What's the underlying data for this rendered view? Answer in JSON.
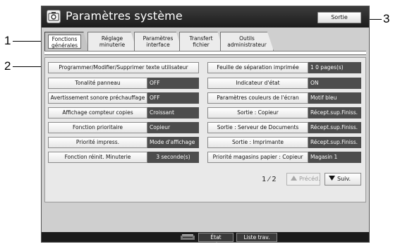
{
  "callouts": {
    "one": "1",
    "two": "2",
    "three": "3"
  },
  "window": {
    "title": "Paramètres système",
    "exit_label": "Sortie"
  },
  "tabs": [
    {
      "line1": "Fonctions",
      "line2": "générales",
      "active": true
    },
    {
      "line1": "Réglage",
      "line2": "minuterie",
      "active": false
    },
    {
      "line1": "Paramètres",
      "line2": "interface",
      "active": false
    },
    {
      "line1": "Transfert",
      "line2": "fichier",
      "active": false
    },
    {
      "line1": "Outils",
      "line2": "administrateur",
      "active": false
    }
  ],
  "settings": {
    "program_button": "Programmer/Modifier/Supprimer texte utilisateur",
    "left": [
      {
        "label": "Tonalité panneau",
        "value": "OFF"
      },
      {
        "label": "Avertissement sonore préchauffage",
        "value": "OFF"
      },
      {
        "label": "Affichage compteur copies",
        "value": "Croissant"
      },
      {
        "label": "Fonction prioritaire",
        "value": "Copieur"
      },
      {
        "label": "Priorité impress.",
        "value": "Mode d'affichage"
      },
      {
        "label": "Fonction réinit. Minuterie",
        "value": "3 seconde(s)"
      }
    ],
    "right": [
      {
        "label": "Feuille de séparation imprimée",
        "value": "1 0 pages(s)"
      },
      {
        "label": "Indicateur d'état",
        "value": "ON"
      },
      {
        "label": "Paramètres couleurs de l'écran",
        "value": "Motif bleu"
      },
      {
        "label": "Sortie : Copieur",
        "value": "Récept.sup.Finiss."
      },
      {
        "label": "Sortie : Serveur de Documents",
        "value": "Récept.sup.Finiss."
      },
      {
        "label": "Sortie : Imprimante",
        "value": "Récept.sup.Finiss."
      },
      {
        "label": "Priorité magasins papier : Copieur",
        "value": "Magasin 1"
      }
    ]
  },
  "pager": {
    "text": "1 ⁄ 2",
    "prev_label": "Précéd.",
    "next_label": "Suiv."
  },
  "footer": {
    "status_button": "État système",
    "jobs_button": "Liste trav."
  },
  "colors": {
    "title_bar": "#1c1c1c",
    "value_bg": "#4d4d4d",
    "panel_bg": "#cfcfcf"
  }
}
